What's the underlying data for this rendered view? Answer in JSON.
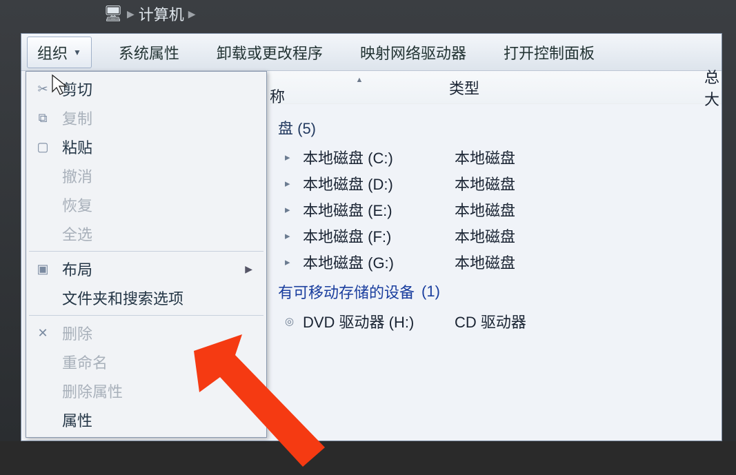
{
  "address": {
    "location": "计算机"
  },
  "toolbar": {
    "organize": "组织",
    "system_properties": "系统属性",
    "uninstall_change": "卸载或更改程序",
    "map_network": "映射网络驱动器",
    "open_control_panel": "打开控制面板"
  },
  "menu": {
    "cut": "剪切",
    "copy": "复制",
    "paste": "粘贴",
    "undo": "撤消",
    "redo": "恢复",
    "select_all": "全选",
    "layout": "布局",
    "folder_search_options": "文件夹和搜索选项",
    "delete": "删除",
    "rename": "重命名",
    "remove_properties": "删除属性",
    "properties": "属性"
  },
  "columns": {
    "name": "称",
    "type": "类型",
    "total_size": "总大"
  },
  "groups": {
    "hard_disks": {
      "label_tail": "盘 (5)"
    },
    "removable": {
      "label": "有可移动存储的设备",
      "count": "(1)"
    }
  },
  "drives": [
    {
      "name": "本地磁盘 (C:)",
      "type": "本地磁盘"
    },
    {
      "name": "本地磁盘 (D:)",
      "type": "本地磁盘"
    },
    {
      "name": "本地磁盘 (E:)",
      "type": "本地磁盘"
    },
    {
      "name": "本地磁盘 (F:)",
      "type": "本地磁盘"
    },
    {
      "name": "本地磁盘 (G:)",
      "type": "本地磁盘"
    }
  ],
  "removable_drives": [
    {
      "name": "DVD 驱动器 (H:)",
      "type": "CD 驱动器"
    }
  ]
}
